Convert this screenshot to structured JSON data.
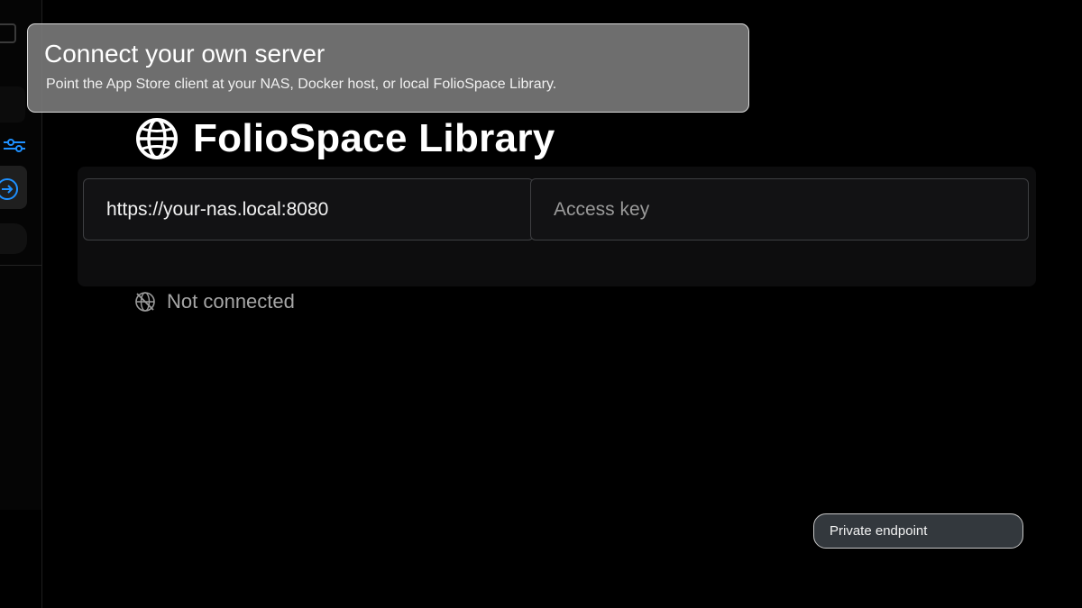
{
  "library": {
    "title": "FolioSpace Library"
  },
  "form": {
    "server_url_value": "https://your-nas.local:8080",
    "access_key_placeholder": "Access key"
  },
  "status": {
    "text": "Not connected"
  },
  "tooltip": {
    "title": "Connect your own server",
    "description": "Point the App Store client at your NAS, Docker host, or local FolioSpace Library."
  },
  "badge": {
    "label": "Private endpoint"
  },
  "colors": {
    "accent": "#1e90ff",
    "background": "#000000",
    "tooltip_bg": "#808080",
    "status_text": "#a6a6a6"
  },
  "icons": {
    "library": "globe-icon",
    "status": "globe-offline-icon",
    "sidebar_active": "arrow-circle-right-icon",
    "sidebar_filter": "sliders-icon"
  }
}
